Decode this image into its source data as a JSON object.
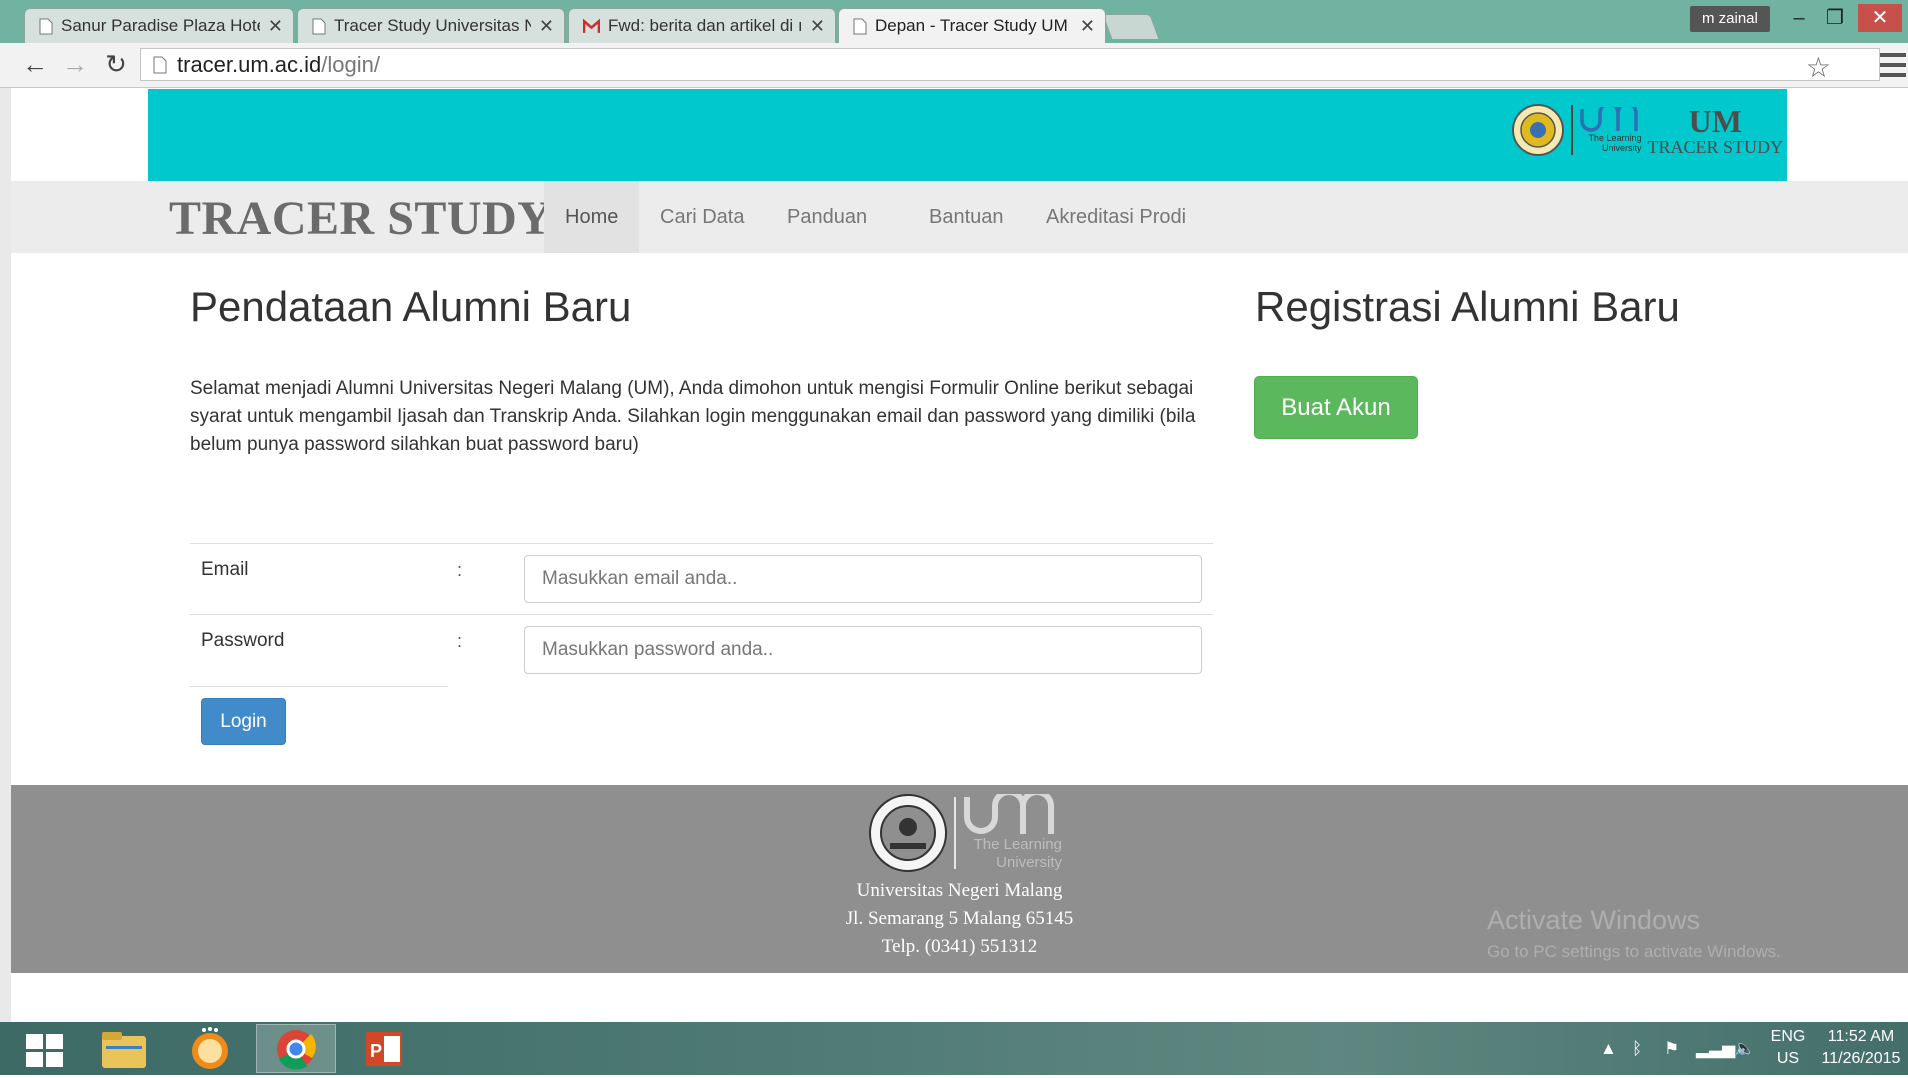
{
  "browser": {
    "tabs": [
      {
        "title": "Sanur Paradise Plaza Hote",
        "icon": "page-icon"
      },
      {
        "title": "Tracer Study Universitas N",
        "icon": "page-icon"
      },
      {
        "title": "Fwd: berita dan artikel di ı",
        "icon": "gmail-icon"
      },
      {
        "title": "Depan - Tracer Study UM",
        "icon": "page-icon",
        "active": true
      }
    ],
    "profile_name": "m zainal",
    "url_host": "tracer.um.ac.id",
    "url_path": "/login/"
  },
  "header": {
    "logo_big": "UM",
    "logo_small": "TRACER STUDY",
    "logo_tagline_1": "The Learning",
    "logo_tagline_2": "University"
  },
  "nav": {
    "site_title": "TRACER STUDY",
    "items": [
      {
        "label": "Home",
        "active": true
      },
      {
        "label": "Cari Data"
      },
      {
        "label": "Panduan"
      },
      {
        "label": "Bantuan"
      },
      {
        "label": "Akreditasi Prodi"
      }
    ]
  },
  "main": {
    "title": "Pendataan Alumni Baru",
    "intro": "Selamat menjadi Alumni Universitas Negeri Malang (UM), Anda dimohon untuk mengisi Formulir Online berikut sebagai syarat untuk mengambil Ijasah dan Transkrip Anda. Silahkan login menggunakan email dan password yang dimiliki (bila belum punya password silahkan buat password baru)",
    "form": {
      "email_label": "Email",
      "email_placeholder": "Masukkan email anda..",
      "password_label": "Password",
      "password_placeholder": "Masukkan password anda..",
      "separator": ":",
      "login_label": "Login"
    }
  },
  "sidebar": {
    "title": "Registrasi Alumni Baru",
    "button_label": "Buat Akun"
  },
  "footer": {
    "logo_tagline_1": "The Learning",
    "logo_tagline_2": "University",
    "line1": "Universitas Negeri Malang",
    "line2": "Jl. Semarang 5 Malang 65145",
    "line3": "Telp. (0341) 551312",
    "watermark_1": "Activate Windows",
    "watermark_2": "Go to PC settings to activate Windows."
  },
  "taskbar": {
    "lang_1": "ENG",
    "lang_2": "US",
    "time": "11:52 AM",
    "date": "11/26/2015"
  },
  "colors": {
    "header_band": "#00c8cc",
    "login_button": "#428bca",
    "create_button": "#5cb85c",
    "footer": "#8f8f8f"
  }
}
